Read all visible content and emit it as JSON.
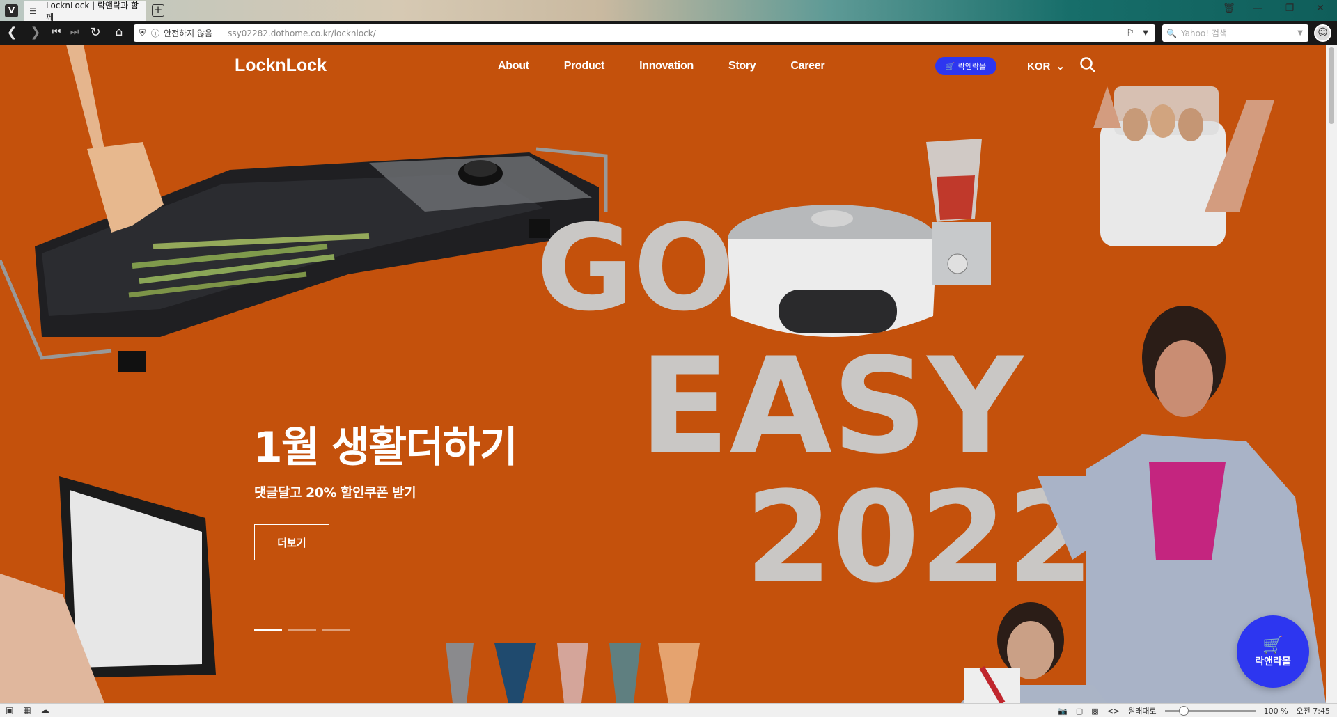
{
  "browser": {
    "logo_letter": "V",
    "tab_title": "LocknLock | 락앤락과 함께",
    "new_tab": "+",
    "security_label": "안전하지 않음",
    "url_host": "ssy02282.dothome.co.kr",
    "url_path": "/locknlock/",
    "search_placeholder": "Yahoo! 검색"
  },
  "site": {
    "logo": "LocknLock",
    "nav": [
      "About",
      "Product",
      "Innovation",
      "Story",
      "Career"
    ],
    "shop_label": "락앤락몰",
    "lang": "KOR"
  },
  "hero": {
    "headline": "1월 생활더하기",
    "subtext": "댓글달고 20% 할인쿠폰 받기",
    "more_button": "더보기",
    "art_text_line1": "GO",
    "art_text_line2": "EASY",
    "art_text_line3": "2022",
    "slides": 3,
    "active_slide": 1
  },
  "fab": {
    "label": "락앤락몰"
  },
  "statusbar": {
    "zoom_mode": "원래대로",
    "zoom": "100 %",
    "time": "오전 7:45"
  },
  "colors": {
    "hero_bg": "#c4510c",
    "accent_blue": "#2d36f0"
  }
}
